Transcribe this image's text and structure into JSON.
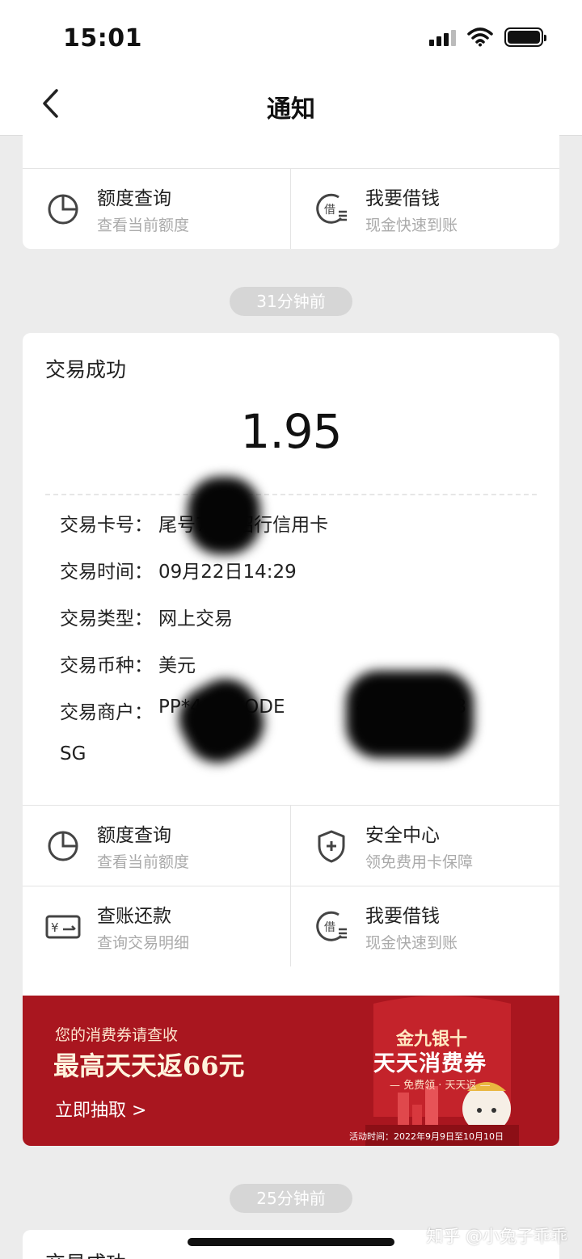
{
  "status_bar": {
    "time": "15:01"
  },
  "nav": {
    "title": "通知"
  },
  "top_card": {
    "actions": [
      {
        "title": "额度查询",
        "subtitle": "查看当前额度",
        "icon": "pie-chart-icon"
      },
      {
        "title": "我要借钱",
        "subtitle": "现金快速到账",
        "icon": "borrow-icon"
      }
    ]
  },
  "notices": [
    {
      "time_ago": "31分钟前",
      "title": "交易成功",
      "amount": "1.95",
      "details": [
        {
          "label": "交易卡号：",
          "value": "尾号7***招行信用卡"
        },
        {
          "label": "交易时间：",
          "value": "09月22日14:29"
        },
        {
          "label": "交易类型：",
          "value": "网上交易"
        },
        {
          "label": "交易币种：",
          "value": "美元"
        },
        {
          "label": "交易商户：",
          "value": "PP*491**ODE            4***357733"
        }
      ],
      "merchant_line2": "SG",
      "actions": [
        {
          "title": "额度查询",
          "subtitle": "查看当前额度",
          "icon": "pie-chart-icon"
        },
        {
          "title": "安全中心",
          "subtitle": "领免费用卡保障",
          "icon": "shield-icon"
        },
        {
          "title": "查账还款",
          "subtitle": "查询交易明细",
          "icon": "bill-icon"
        },
        {
          "title": "我要借钱",
          "subtitle": "现金快速到账",
          "icon": "borrow-icon"
        }
      ],
      "banner": {
        "subtitle": "您的消费券请查收",
        "headline": "最高天天返66元",
        "cta": "立即抽取 >",
        "promo_top": "金九银十",
        "promo_main": "天天消费券",
        "promo_tag": "— 免费领 · 天天返 —",
        "promo_date": "活动时间：2022年9月9日至10月10日",
        "background_color": "#a9161f"
      }
    },
    {
      "time_ago": "25分钟前",
      "title": "交易成功"
    }
  ],
  "watermark": "知乎 @小兔子乖乖"
}
